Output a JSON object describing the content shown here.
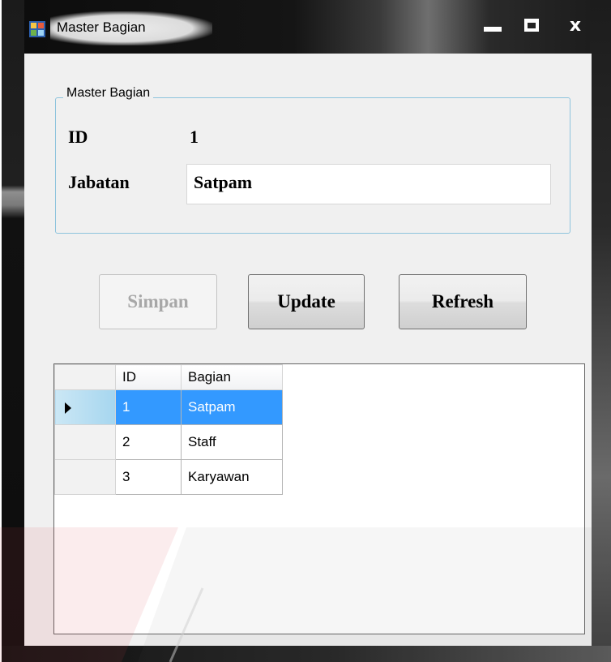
{
  "window": {
    "title": "Master Bagian",
    "close_glyph": "x",
    "icon": "app-window-icon"
  },
  "group": {
    "legend": "Master Bagian",
    "id_label": "ID",
    "id_value": "1",
    "jabatan_label": "Jabatan",
    "jabatan_value": "Satpam"
  },
  "buttons": {
    "simpan": "Simpan",
    "update": "Update",
    "refresh": "Refresh"
  },
  "grid": {
    "columns": [
      "ID",
      "Bagian"
    ],
    "rows": [
      {
        "id": "1",
        "bagian": "Satpam",
        "selected": true
      },
      {
        "id": "2",
        "bagian": "Staff",
        "selected": false
      },
      {
        "id": "3",
        "bagian": "Karyawan",
        "selected": false
      }
    ]
  },
  "colors": {
    "selection": "#3399ff",
    "group_border": "#8ec4dd",
    "client_bg": "#f0f0f0"
  }
}
